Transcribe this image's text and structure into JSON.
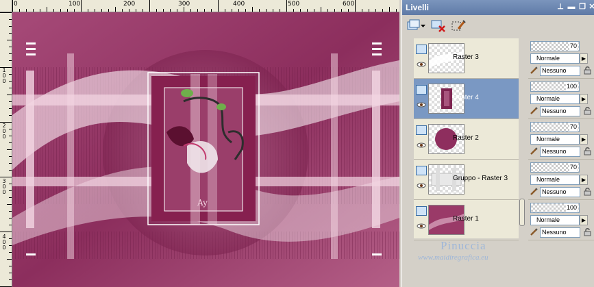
{
  "ruler": {
    "top_labels": [
      "0",
      "100",
      "200",
      "300",
      "400",
      "500",
      "600"
    ],
    "left_labels": [
      "1\n0\n0",
      "2\n0\n0",
      "3\n0\n0",
      "4\n0\n0"
    ]
  },
  "panel": {
    "title": "Livelli",
    "title_buttons": [
      "pin-icon",
      "minimize-icon",
      "restore-icon",
      "close-icon"
    ]
  },
  "toolbar": {
    "items": [
      "new-layer-icon",
      "dropdown-arrow-icon",
      "delete-layer-icon",
      "edit-layer-icon"
    ]
  },
  "layers": [
    {
      "name": "Raster 3",
      "selected": false,
      "opacity": "70",
      "blend": "Normale",
      "mask": "Nessuno"
    },
    {
      "name": "Raster 4",
      "selected": true,
      "opacity": "100",
      "blend": "Normale",
      "mask": "Nessuno"
    },
    {
      "name": "Raster 2",
      "selected": false,
      "opacity": "70",
      "blend": "Normale",
      "mask": "Nessuno"
    },
    {
      "name": "Gruppo - Raster 3",
      "selected": false,
      "opacity": "70",
      "blend": "Normale",
      "mask": "Nessuno"
    },
    {
      "name": "Raster 1",
      "selected": false,
      "opacity": "100",
      "blend": "Normale",
      "mask": "Nessuno"
    }
  ],
  "watermark": {
    "name": "Pinuccia",
    "url": "www.maidiregrafica.eu"
  },
  "colors": {
    "canvas_base": "#8a2a5a",
    "canvas_light": "#e9c6d6",
    "selection": "#7a98c3",
    "panel_title": "#6a86b2"
  }
}
